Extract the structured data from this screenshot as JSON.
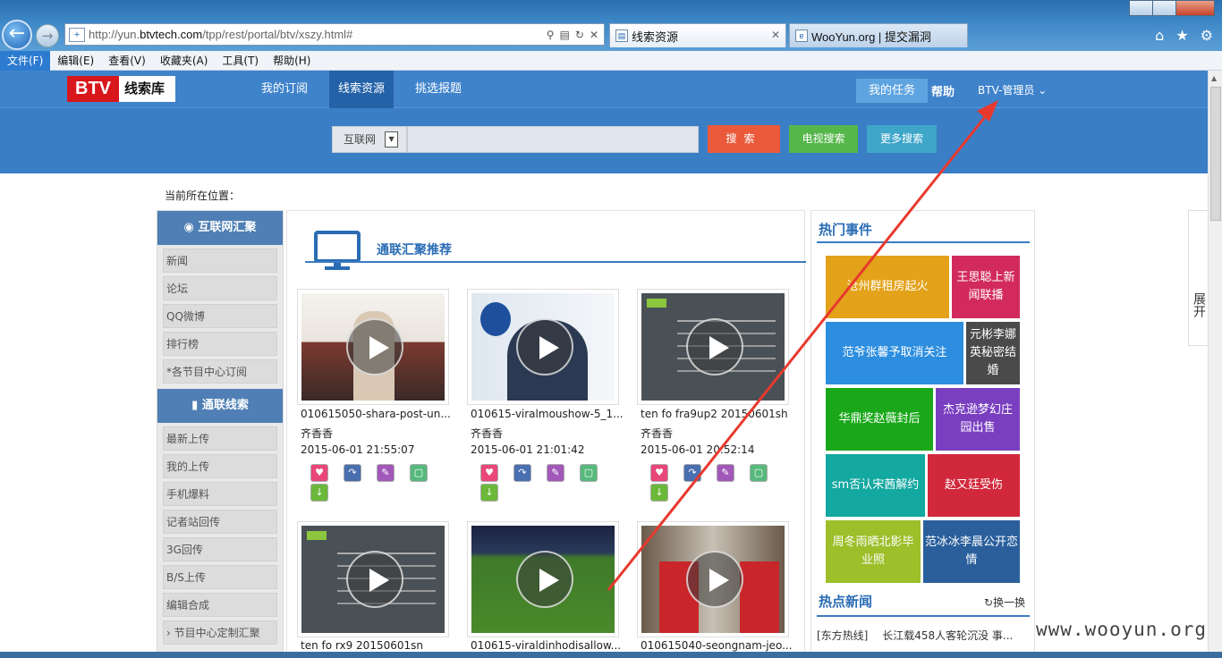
{
  "browser": {
    "url_prefix": "http://yun.",
    "url_domain": "btvtech.com",
    "url_path": "/tpp/rest/portal/btv/xszy.html#",
    "tabs": [
      {
        "label": "线索资源"
      },
      {
        "label": "WooYun.org | 提交漏洞"
      }
    ],
    "menu": [
      "文件(F)",
      "编辑(E)",
      "查看(V)",
      "收藏夹(A)",
      "工具(T)",
      "帮助(H)"
    ]
  },
  "header": {
    "logo_btv": "BTV",
    "logo_text": "线索库",
    "nav": [
      "我的订阅",
      "线索资源",
      "挑选报题"
    ],
    "my_task": "我的任务",
    "help": "帮助",
    "user": "BTV-管理员 ⌄"
  },
  "search": {
    "scope": "互联网",
    "search_button": "搜索",
    "tv_search": "电视搜索",
    "more_search": "更多搜索"
  },
  "breadcrumb": "当前所在位置：",
  "sidebar": {
    "section1_title": "互联网汇聚",
    "section1_items": [
      "新闻",
      "论坛",
      "QQ微博",
      "排行榜",
      "*各节目中心订阅"
    ],
    "section2_title": "通联线索",
    "section2_items": [
      "最新上传",
      "我的上传",
      "手机爆料",
      "记者站回传",
      "3G回传",
      "B/S上传",
      "编辑合成",
      "节目中心定制汇聚"
    ]
  },
  "main": {
    "title": "通联汇聚推荐",
    "videos": [
      {
        "title": "010615050-shara-post-un...",
        "author": "齐香香",
        "date": "2015-06-01 21:55:07"
      },
      {
        "title": "010615-viralmoushow-5_1...",
        "author": "齐香香",
        "date": "2015-06-01 21:01:42"
      },
      {
        "title": "ten fo fra9up2 20150601sh",
        "author": "齐香香",
        "date": "2015-06-01 20:52:14"
      },
      {
        "title": "ten fo rx9 20150601sn",
        "author": "",
        "date": ""
      },
      {
        "title": "010615-viraldinhodisallow...",
        "author": "",
        "date": ""
      },
      {
        "title": "010615040-seongnam-jeo...",
        "author": "",
        "date": ""
      }
    ]
  },
  "hot": {
    "title": "热门事件",
    "tiles": [
      {
        "label": "沧州群租房起火",
        "color": "#e3a21a"
      },
      {
        "label": "王思聪上新闻联播",
        "color": "#d22a5c"
      },
      {
        "label": "范爷张馨予取消关注",
        "color": "#2d8ee0"
      },
      {
        "label": "元彬李娜英秘密结婚",
        "color": "#4a4a4a"
      },
      {
        "label": "华鼎奖赵薇封后",
        "color": "#1aa81a"
      },
      {
        "label": "杰克逊梦幻庄园出售",
        "color": "#7a3fc0"
      },
      {
        "label": "sm否认宋茜解约",
        "color": "#13a8a0"
      },
      {
        "label": "赵又廷受伤",
        "color": "#d2283c"
      },
      {
        "label": "周冬雨晒北影毕业照",
        "color": "#9cbf2a"
      },
      {
        "label": "范冰冰李晨公开恋情",
        "color": "#2a5f9c"
      }
    ],
    "news_title": "热点新闻",
    "swap": "换一换",
    "news": [
      {
        "source": "[东方热线]",
        "text": "长江载458人客轮沉没 事..."
      }
    ]
  },
  "expand": "展开",
  "watermark": "www.wooyun.org",
  "colors": {
    "brand_blue": "#3a7ec6",
    "nav_active": "#2462a8",
    "search_red": "#ea5a3a",
    "annotation_red": "#e8392e"
  }
}
